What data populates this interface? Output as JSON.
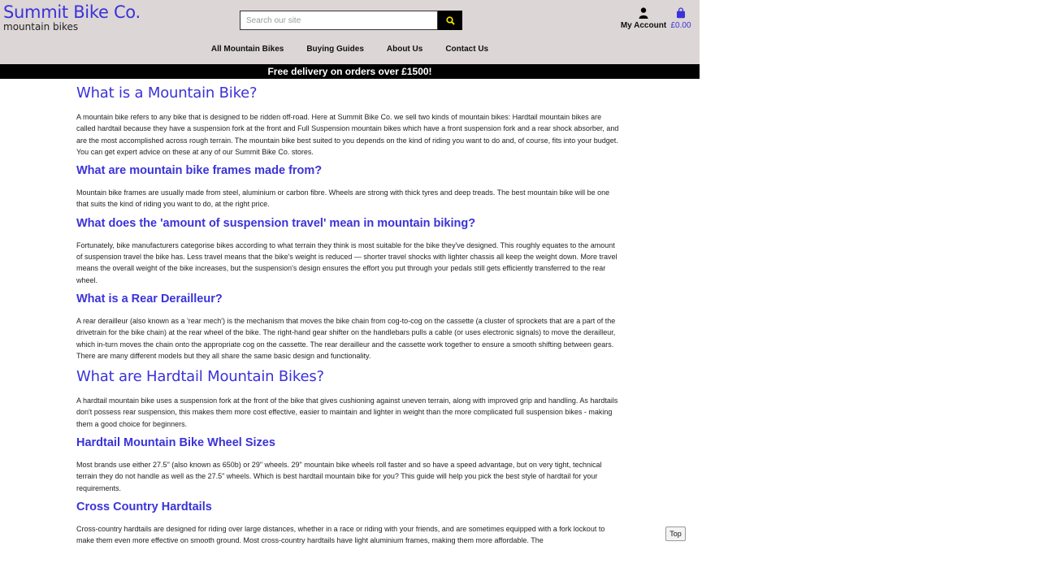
{
  "header": {
    "brand_name": "Summit Bike Co.",
    "brand_tagline": "mountain bikes",
    "search_placeholder": "Search our site",
    "account_label": "My Account",
    "bag_total": "£0.00"
  },
  "nav": {
    "items": [
      "All Mountain Bikes",
      "Buying Guides",
      "About Us",
      "Contact Us"
    ]
  },
  "promo_banner": "Free delivery on orders over £1500!",
  "article": {
    "sections": [
      {
        "heading": "What is a Mountain Bike?",
        "body": "A mountain bike refers to any bike that is designed to be ridden off-road. Here at Summit Bike Co. we sell two kinds of mountain bikes: Hardtail mountain bikes are called hardtail because they have a suspension fork at the front and Full Suspension mountain bikes which have a front suspension fork and a rear shock absorber, and are the most accomplished across rough terrain. The mountain bike best suited to you depends on the kind of riding you want to do and, of course, fits into your budget. You can get expert advice on these at any of our Summit Bike Co. stores."
      },
      {
        "heading": "What are mountain bike frames made from?",
        "body": "Mountain bike frames are usually made from steel, aluminium or carbon fibre. Wheels are strong with thick tyres and deep treads. The best mountain bike will be one that suits the kind of riding you want to do, at the right price."
      },
      {
        "heading": "What does the 'amount of suspension travel' mean in mountain biking?",
        "body": "Fortunately, bike manufacturers categorise bikes according to what terrain they think is most suitable for the bike they've designed. This roughly equates to the amount of suspension travel the bike has. Less travel means that the bike's weight is reduced — shorter travel shocks with lighter chassis all keep the weight down. More travel means the overall weight of the bike increases, but the suspension's design ensures the effort you put through your pedals still gets efficiently transferred to the rear wheel."
      },
      {
        "heading": "What is a Rear Derailleur?",
        "body": "A rear derailleur (also known as a 'rear mech') is the mechanism that moves the bike chain from cog-to-cog on the cassette (a cluster of sprockets that are a part of the drivetrain for the bike chain) at the rear wheel of the bike. The right-hand gear shifter on the handlebars pulls a cable (or uses electronic signals) to move the derailleur, which in-turn moves the chain onto the appropriate cog on the cassette. The rear derailleur and the cassette work together to ensure a smooth shifting between gears. There are many different models but they all share the same basic design and functionality."
      },
      {
        "heading": "What are Hardtail Mountain Bikes?",
        "body": "A hardtail mountain bike uses a suspension fork at the front of the bike that gives cushioning against uneven terrain, along with improved grip and handling. As hardtails don't possess rear suspension, this makes them more cost effective, easier to maintain and lighter in weight than the more complicated full suspension bikes - making them a good choice for beginners."
      },
      {
        "heading": "Hardtail Mountain Bike Wheel Sizes",
        "body": "Most brands use either 27.5\" (also known as 650b) or 29\" wheels. 29\" mountain bike wheels roll faster and so have a speed advantage, but on very tight, technical terrain they do not handle as well as the 27.5\" wheels. Which is best hardtail mountain bike for you? This guide will help you pick the best style of hardtail for your requirements."
      },
      {
        "heading": "Cross Country Hardtails",
        "body": "Cross-country hardtails are designed for riding over large distances, whether in a race or riding with your friends, and are sometimes equipped with a fork lockout to make them even more effective on smooth ground. Most cross-country hardtails have light aluminium frames, making them more affordable. The"
      }
    ]
  },
  "top_button_label": "Top",
  "colors": {
    "brand_blue": "#3b32d8",
    "header_bg": "#dcd6d6",
    "banner_bg": "#000000"
  },
  "icons": {
    "search": "search-icon",
    "account": "user-icon",
    "bag": "shopping-bag-icon"
  }
}
